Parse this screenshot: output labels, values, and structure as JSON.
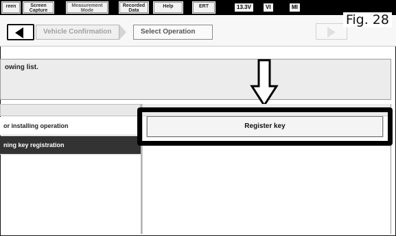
{
  "toolbar": {
    "buttons": [
      {
        "lines": [
          "reen"
        ]
      },
      {
        "lines": [
          "Screen",
          "Capture"
        ]
      },
      {
        "lines": [
          "Measurement",
          "Mode"
        ]
      },
      {
        "lines": [
          "Recorded",
          "Data"
        ]
      },
      {
        "lines": [
          "Help"
        ]
      },
      {
        "lines": [
          "ERT"
        ]
      }
    ],
    "voltage": "13.3V",
    "vi_label": "VI",
    "mi_label": "MI"
  },
  "breadcrumb": {
    "step1": "Vehicle Confirmation",
    "step2": "Select Operation"
  },
  "figure_label": "Fig. 28",
  "instruction": {
    "text": "owing list."
  },
  "operation_list": {
    "items": [
      {
        "label": "or installing operation"
      },
      {
        "label": "ning key registration"
      }
    ]
  },
  "right_panel": {
    "register_button_label": "Register key"
  },
  "colors": {
    "highlight_border": "#000000",
    "selected_row": "#333333",
    "toolbar_bg": "#000000"
  }
}
